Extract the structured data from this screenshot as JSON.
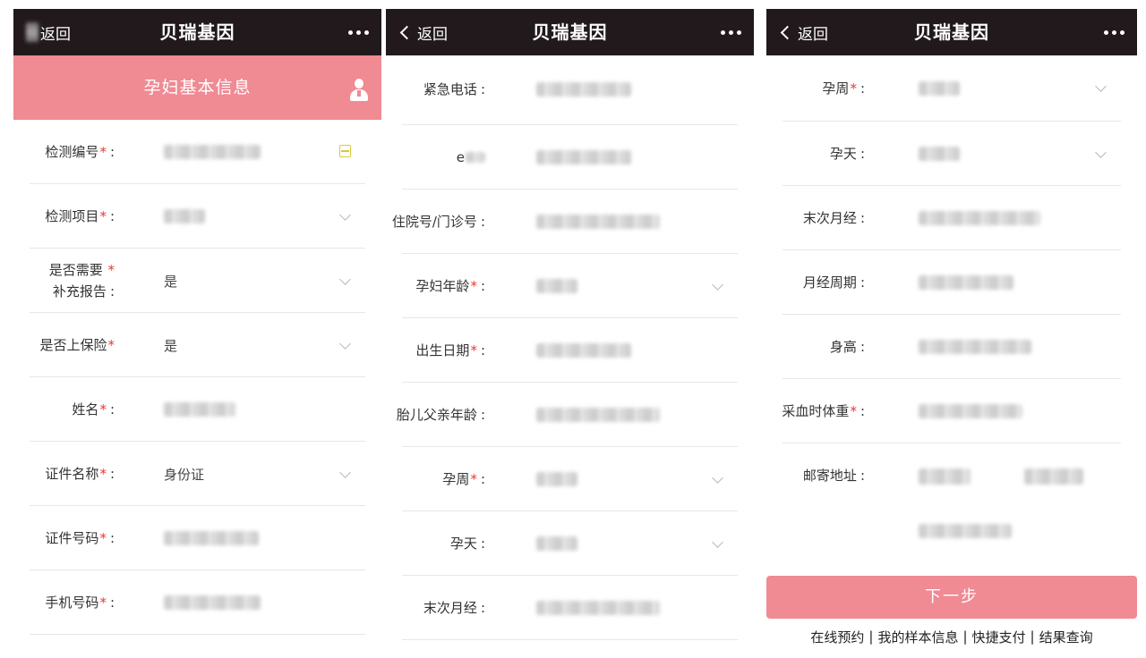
{
  "app": {
    "title": "贝瑞基因",
    "back_label": "返回"
  },
  "panel1": {
    "section_title": "孕妇基本信息",
    "rows": [
      {
        "label": "检测编号",
        "required": true,
        "value": "",
        "control": "scan"
      },
      {
        "label": "检测项目",
        "required": true,
        "value": "",
        "control": "select"
      },
      {
        "label_line1": "是否需要",
        "label_line2": "补充报告",
        "required": true,
        "value": "是",
        "control": "select"
      },
      {
        "label": "是否上保险",
        "required": true,
        "value": "是",
        "control": "select"
      },
      {
        "label": "姓名",
        "required": true,
        "value": "",
        "control": "none"
      },
      {
        "label": "证件名称",
        "required": true,
        "value": "身份证",
        "control": "select"
      },
      {
        "label": "证件号码",
        "required": true,
        "value": "",
        "control": "none"
      },
      {
        "label": "手机号码",
        "required": true,
        "value": "",
        "control": "none"
      }
    ]
  },
  "panel2": {
    "rows": [
      {
        "label": "紧急电话",
        "required": false,
        "value": ""
      },
      {
        "label": "e",
        "required": false,
        "value": ""
      },
      {
        "label": "住院号/门诊号",
        "required": false,
        "value": ""
      },
      {
        "label": "孕妇年龄",
        "required": true,
        "value": "",
        "control": "select"
      },
      {
        "label": "出生日期",
        "required": true,
        "value": ""
      },
      {
        "label": "胎儿父亲年龄",
        "required": false,
        "value": ""
      },
      {
        "label": "孕周",
        "required": true,
        "value": "",
        "control": "select"
      },
      {
        "label": "孕天",
        "required": false,
        "value": "",
        "control": "select"
      },
      {
        "label": "末次月经",
        "required": false,
        "value": ""
      }
    ]
  },
  "panel3": {
    "rows": [
      {
        "label": "孕周",
        "required": true,
        "value": "",
        "control": "select"
      },
      {
        "label": "孕天",
        "required": false,
        "value": "",
        "control": "select"
      },
      {
        "label": "末次月经",
        "required": false,
        "value": ""
      },
      {
        "label": "月经周期",
        "required": false,
        "value": ""
      },
      {
        "label": "身高",
        "required": false,
        "value": ""
      },
      {
        "label": "采血时体重",
        "required": true,
        "value": ""
      },
      {
        "label": "邮寄地址",
        "required": false,
        "value": ""
      }
    ],
    "next_button": "下一步",
    "footer_links": [
      "在线预约",
      "我的样本信息",
      "快捷支付",
      "结果查询"
    ],
    "footer_separator": "|"
  },
  "colors": {
    "nav_bg": "#22191d",
    "accent_pink": "#f08a93",
    "required": "#e33333"
  }
}
